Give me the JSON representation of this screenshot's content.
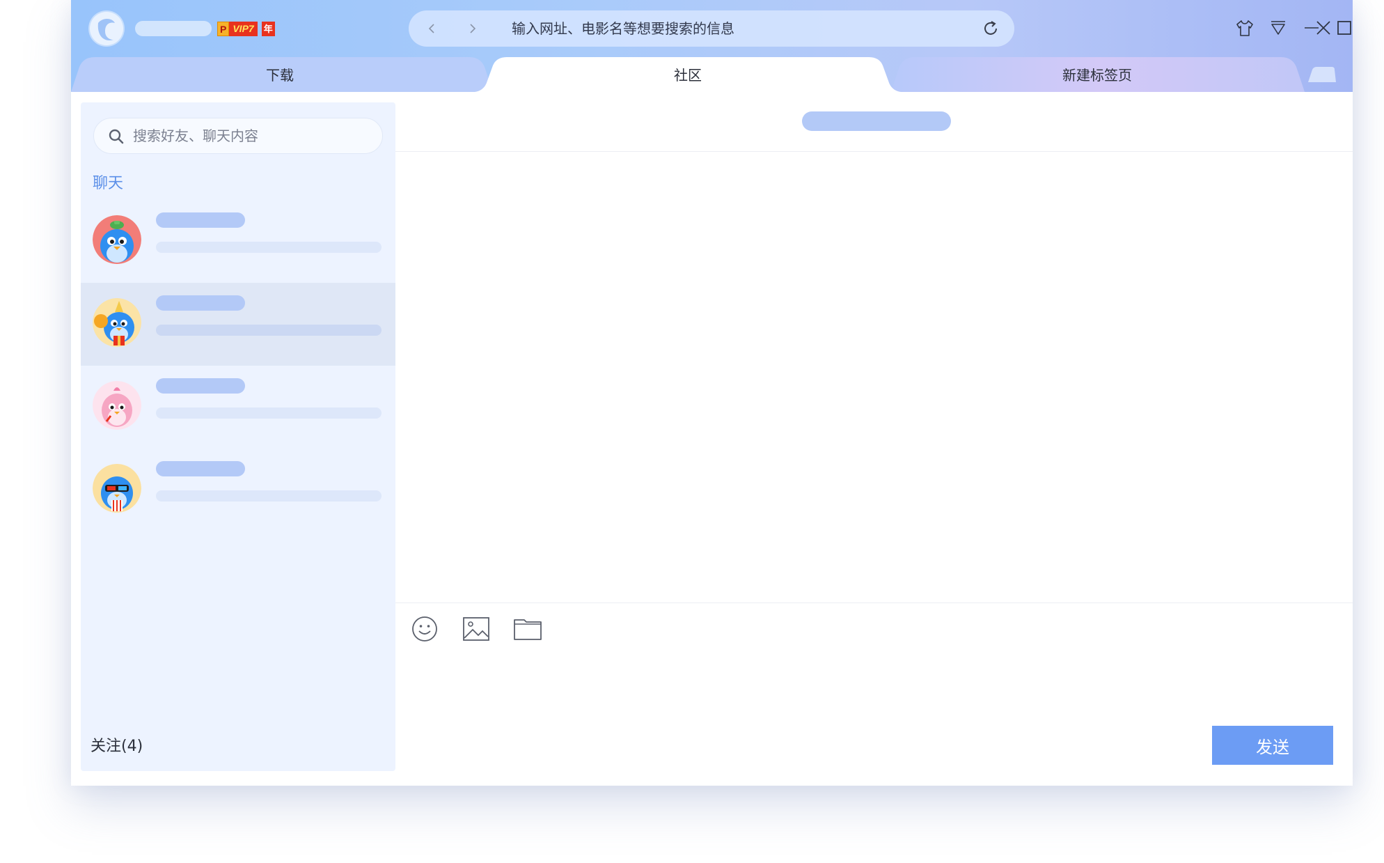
{
  "titlebar": {
    "vip": {
      "p": "P",
      "level": "VIP7",
      "year": "年"
    }
  },
  "address": {
    "placeholder": "输入网址、电影名等想要搜索的信息"
  },
  "tabs": [
    {
      "label": "下载"
    },
    {
      "label": "社区"
    },
    {
      "label": "新建标签页"
    }
  ],
  "sidebar": {
    "search_placeholder": "搜索好友、聊天内容",
    "section_title": "聊天",
    "follow_label": "关注(4)"
  },
  "chat": {
    "send_label": "发送"
  },
  "colors": {
    "accent": "#6c9cf4",
    "section_title": "#5b8fe8",
    "skeleton": "#b3c9f7",
    "sidebar_bg": "#edf3ff"
  }
}
